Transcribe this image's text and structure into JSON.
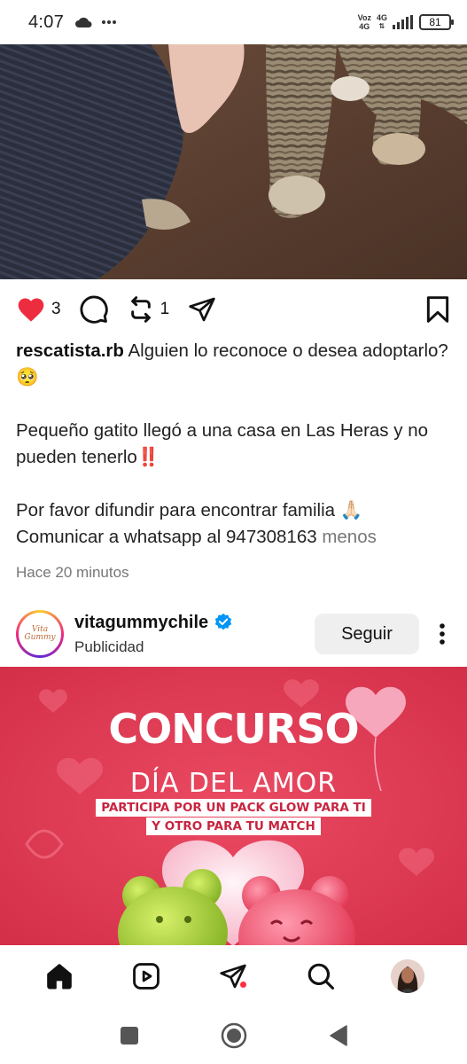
{
  "status_bar": {
    "time": "4:07",
    "network_top": "Voz",
    "network_bottom": "4G",
    "network_type": "4G",
    "battery": "81"
  },
  "post": {
    "likes": "3",
    "reposts": "1",
    "username": "rescatista.rb",
    "caption_line1": " Alguien lo reconoce o desea adoptarlo? 🥺",
    "caption_line2": "Pequeño gatito llegó a una casa en Las Heras y no pueden tenerlo‼️",
    "caption_line3": "Por favor difundir para encontrar familia 🙏🏻 Comunicar a whatsapp al 947308163",
    "less_link": "menos",
    "timestamp": "Hace 20 minutos",
    "like_color": "#ed2d3f"
  },
  "ad": {
    "account": "vitagummychile",
    "label": "Publicidad",
    "follow_label": "Seguir",
    "avatar_text_1": "Vita",
    "avatar_text_2": "Gummy",
    "title": "CONCURSO",
    "subtitle": "DÍA DEL AMOR",
    "band_line1": "PARTICIPA POR UN PACK GLOW PARA TI",
    "band_line2": "Y OTRO PARA TU MATCH",
    "bg_color": "#e23d57"
  },
  "icons": {
    "like": "heart-icon",
    "comment": "comment-icon",
    "repost": "repost-icon",
    "share": "send-icon",
    "save": "bookmark-icon",
    "verified": "verified-badge-icon",
    "more": "more-options-icon",
    "nav": [
      "home-icon",
      "reels-icon",
      "messages-icon",
      "search-icon",
      "profile-avatar"
    ],
    "system": [
      "recent-apps-icon",
      "home-circle-icon",
      "back-icon"
    ]
  }
}
